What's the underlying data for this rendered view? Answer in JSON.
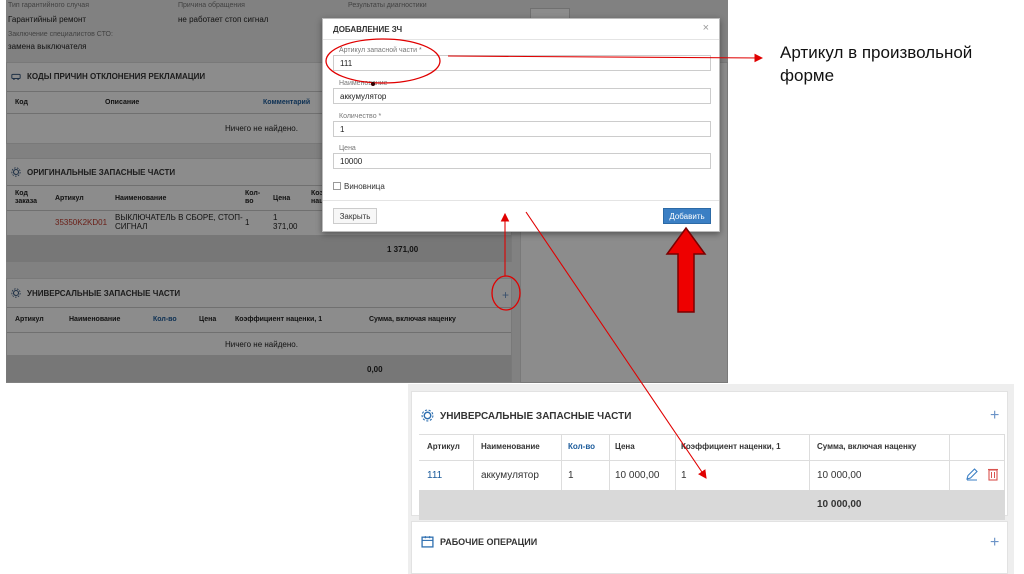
{
  "background": {
    "top_fields": [
      {
        "label": "Тип гарантийного случая",
        "value": "Гарантийный ремонт"
      },
      {
        "label": "Причина обращения",
        "value": "не работает стоп сигнал"
      },
      {
        "label": "Результаты диагностики",
        "value": ""
      },
      {
        "label": "Заключение специалистов СТО:",
        "value": "замена выключателя"
      }
    ],
    "codes_panel": {
      "title": "КОДЫ ПРИЧИН ОТКЛОНЕНИЯ РЕКЛАМАЦИИ",
      "columns": [
        "Код",
        "Описание",
        "Комментарий"
      ],
      "empty": "Ничего не найдено."
    },
    "original_parts": {
      "title": "ОРИГИНАЛЬНЫЕ ЗАПАСНЫЕ ЧАСТИ",
      "columns": [
        "Код заказа",
        "Артикул",
        "Наименование",
        "Кол-во",
        "Цена",
        "Коэ нацен"
      ],
      "row": {
        "article": "35350K2KD01",
        "name": "ВЫКЛЮЧАТЕЛЬ В СБОРЕ, СТОП-СИГНАЛ",
        "qty": "1",
        "price": "1 371,00"
      },
      "total": "1 371,00"
    },
    "universal_parts": {
      "title": "УНИВЕРСАЛЬНЫЕ ЗАПАСНЫЕ ЧАСТИ",
      "columns": [
        "Артикул",
        "Наименование",
        "Кол-во",
        "Цена",
        "Коэффициент наценки, 1",
        "Сумма, включая наценку"
      ],
      "empty": "Ничего не найдено.",
      "total": "0,00"
    }
  },
  "modal": {
    "title": "ДОБАВЛЕНИЕ ЗЧ",
    "close_glyph": "×",
    "fields": {
      "article": {
        "label": "Артикул запасной части *",
        "value": "111"
      },
      "name": {
        "label": "Наименование",
        "value": "аккумулятор"
      },
      "quantity": {
        "label": "Количество *",
        "value": "1"
      },
      "price": {
        "label": "Цена",
        "value": "10000"
      }
    },
    "culprit_label": "Виновница",
    "close_button": "Закрыть",
    "add_button": "Добавить"
  },
  "annotation": {
    "line1": "Артикул в произвольной",
    "line2": "форме",
    "color": "#e00000"
  },
  "detail": {
    "universal_title": "УНИВЕРСАЛЬНЫЕ ЗАПАСНЫЕ ЧАСТИ",
    "columns": [
      "Артикул",
      "Наименование",
      "Кол-во",
      "Цена",
      "Коэффициент наценки, 1",
      "Сумма, включая наценку"
    ],
    "row": {
      "article": "111",
      "name": "аккумулятор",
      "qty": "1",
      "price": "10 000,00",
      "coef": "1",
      "sum": "10 000,00"
    },
    "total": "10 000,00",
    "work_title": "РАБОЧИЕ ОПЕРАЦИИ",
    "plus_glyph": "+"
  },
  "icons": {
    "panel_icon": "gear-icon",
    "codes_icon": "car-icon",
    "edit_icon": "pencil-icon",
    "delete_icon": "trash-icon",
    "work_icon": "calendar-icon"
  },
  "colors": {
    "primary_button": "#3b7fc4",
    "link_blue": "#1a5a9a",
    "annotation_red": "#e00000"
  }
}
